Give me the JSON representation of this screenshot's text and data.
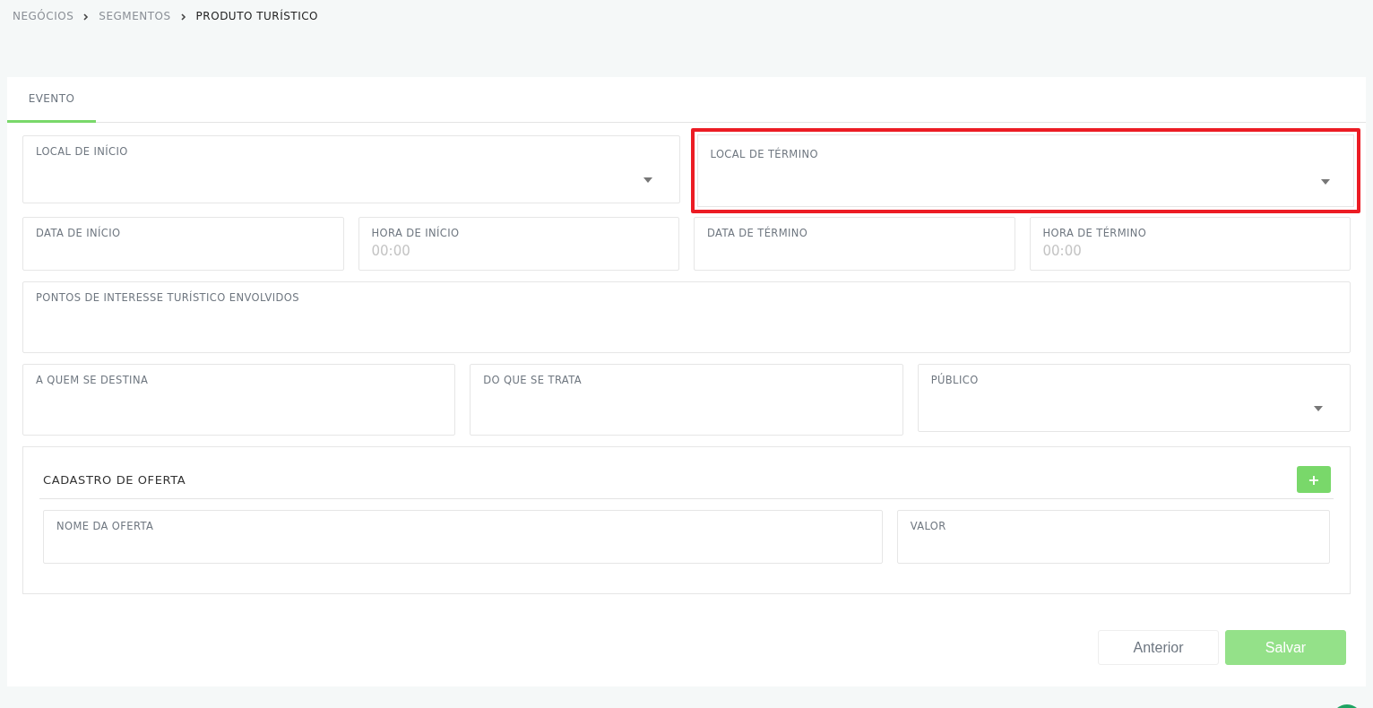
{
  "breadcrumb": [
    {
      "label": "NEGÓCIOS",
      "current": false
    },
    {
      "label": "SEGMENTOS",
      "current": false
    },
    {
      "label": "PRODUTO TURÍSTICO",
      "current": true
    }
  ],
  "tabs": [
    {
      "label": "EVENTO",
      "selected": true
    }
  ],
  "rows": [
    {
      "fields": [
        {
          "kind": "select",
          "label": "LOCAL DE INÍCIO",
          "highlighted": false
        },
        {
          "kind": "select",
          "label": "LOCAL DE TÉRMINO",
          "highlighted": true
        }
      ]
    },
    {
      "fields": [
        {
          "kind": "text",
          "label": "DATA DE INÍCIO",
          "highlighted": false
        },
        {
          "kind": "text",
          "label": "HORA DE INÍCIO",
          "placeholder": "00:00",
          "highlighted": false
        },
        {
          "kind": "text",
          "label": "DATA DE TÉRMINO",
          "highlighted": false
        },
        {
          "kind": "text",
          "label": "HORA DE TÉRMINO",
          "placeholder": "00:00",
          "highlighted": false
        }
      ]
    },
    {
      "fields": [
        {
          "kind": "area",
          "label": "PONTOS DE INTERESSE TURÍSTICO ENVOLVIDOS",
          "highlighted": false
        }
      ]
    },
    {
      "fields": [
        {
          "kind": "area",
          "label": "A QUEM SE DESTINA",
          "highlighted": false
        },
        {
          "kind": "area",
          "label": "DO QUE SE TRATA",
          "highlighted": false
        },
        {
          "kind": "select",
          "label": "PÚBLICO",
          "highlighted": false
        }
      ]
    }
  ],
  "offer": {
    "title": "CADASTRO DE OFERTA",
    "add_button": "+",
    "fields": [
      {
        "kind": "text",
        "label": "NOME DA OFERTA",
        "highlighted": false
      },
      {
        "kind": "text",
        "label": "VALOR",
        "highlighted": false
      }
    ]
  },
  "buttons": [
    {
      "label": "Anterior",
      "kind": "secondary"
    },
    {
      "label": "Salvar",
      "kind": "primary"
    }
  ]
}
